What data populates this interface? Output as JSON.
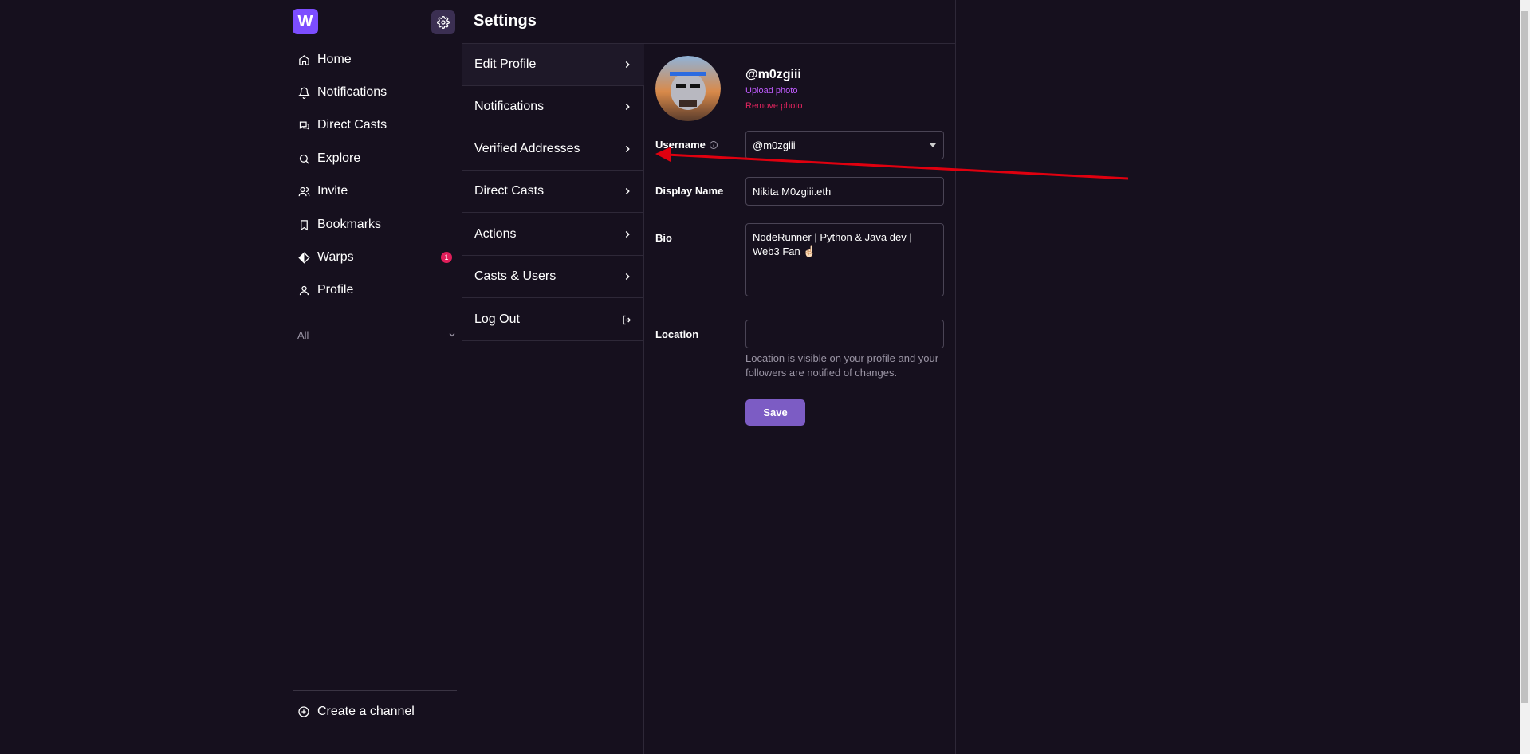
{
  "app": {
    "logo_letter": "W"
  },
  "sidebar": {
    "items": [
      {
        "label": "Home",
        "icon": "home-icon"
      },
      {
        "label": "Notifications",
        "icon": "bell-icon"
      },
      {
        "label": "Direct Casts",
        "icon": "chat-icon"
      },
      {
        "label": "Explore",
        "icon": "search-icon"
      },
      {
        "label": "Invite",
        "icon": "users-icon"
      },
      {
        "label": "Bookmarks",
        "icon": "bookmark-icon"
      },
      {
        "label": "Warps",
        "icon": "diamond-icon",
        "badge": "1"
      },
      {
        "label": "Profile",
        "icon": "user-icon"
      }
    ],
    "filter_label": "All",
    "create_channel": "Create a channel"
  },
  "settings": {
    "title": "Settings",
    "menu": [
      {
        "label": "Edit Profile"
      },
      {
        "label": "Notifications"
      },
      {
        "label": "Verified Addresses"
      },
      {
        "label": "Direct Casts"
      },
      {
        "label": "Actions"
      },
      {
        "label": "Casts & Users"
      },
      {
        "label": "Log Out"
      }
    ]
  },
  "profile": {
    "handle": "@m0zgiii",
    "upload_photo": "Upload photo",
    "remove_photo": "Remove photo",
    "username_label": "Username",
    "username_value": "@m0zgiii",
    "display_name_label": "Display Name",
    "display_name_value": "Nikita M0zgiii.eth",
    "bio_label": "Bio",
    "bio_value": "NodeRunner | Python & Java dev | Web3 Fan ☝🏻",
    "location_label": "Location",
    "location_value": "",
    "location_hint": "Location is visible on your profile and your followers are notified of changes.",
    "save_label": "Save"
  },
  "colors": {
    "background": "#16101e",
    "accent": "#7c4dff",
    "save_button": "#7c5cc4",
    "upload_link": "#c15cff",
    "remove_link": "#e0245e",
    "annotation_arrow": "#e0000f"
  }
}
